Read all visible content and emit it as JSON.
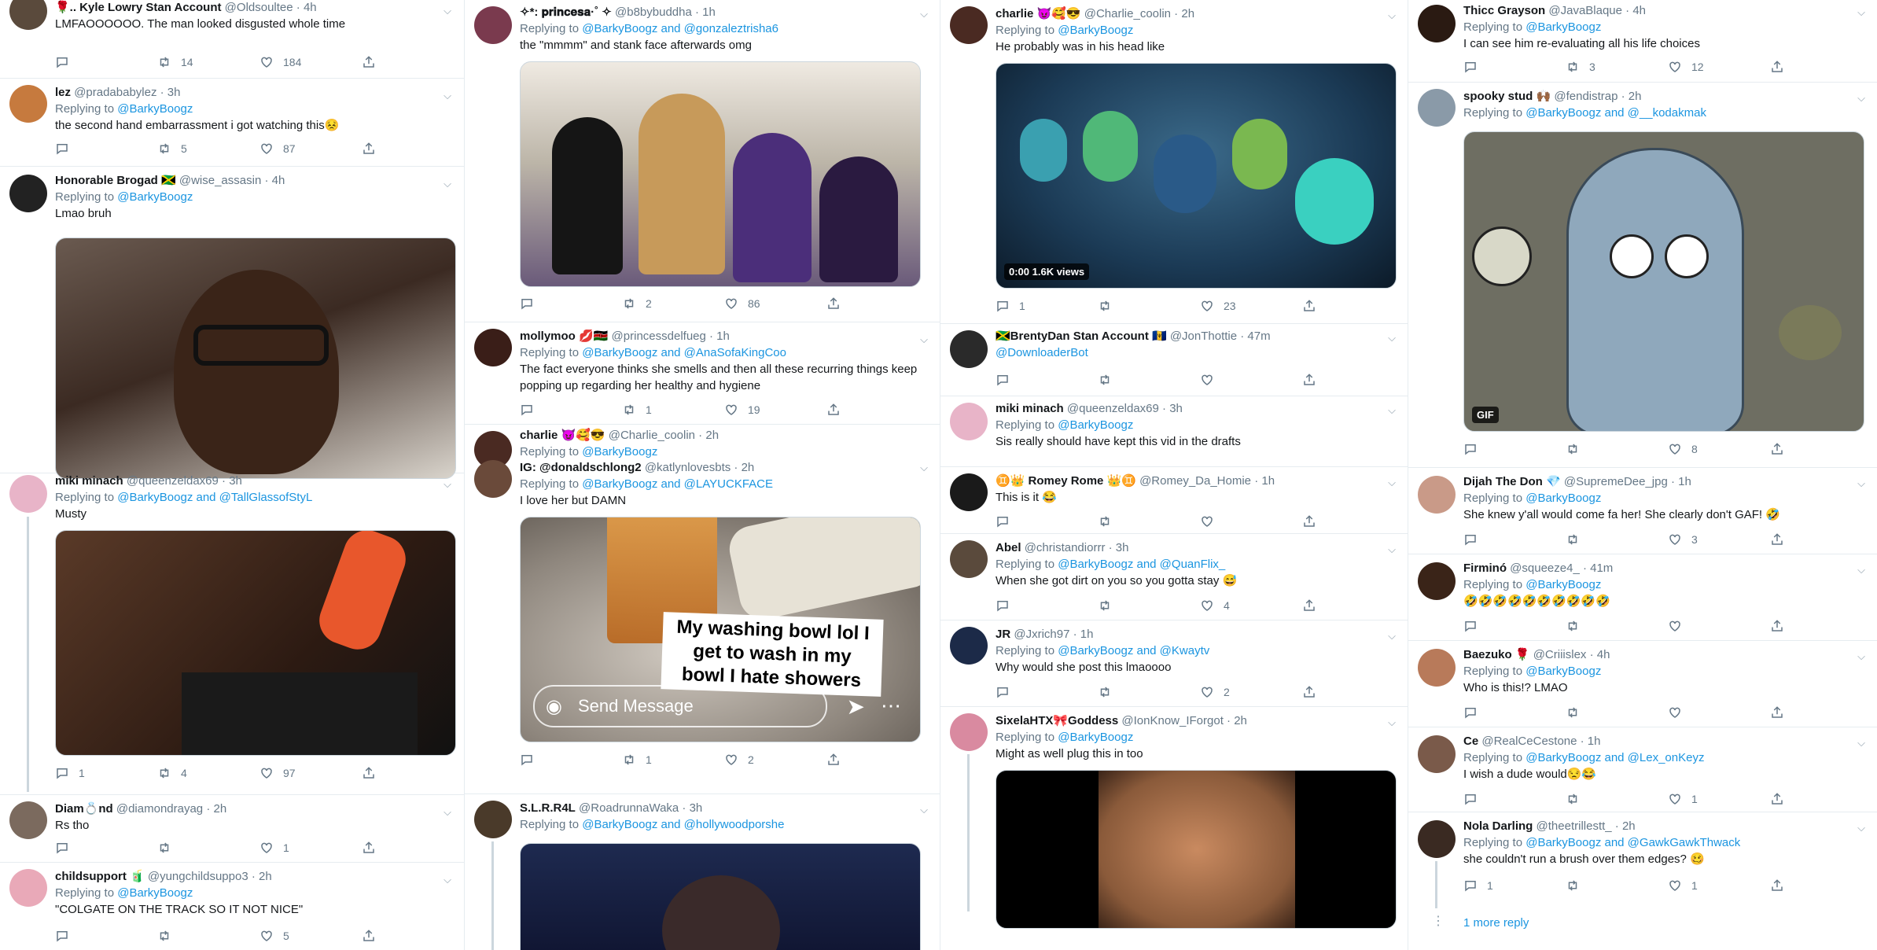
{
  "col1": [
    {
      "name": "🌹.. Kyle Lowry Stan Account",
      "handle": "@Oldsoultee · 4h",
      "text": "LMFAOOOOOO. The man looked disgusted whole time",
      "reply_to": "@BarkyBoogz",
      "replies": "",
      "retweets": "14",
      "likes": "184"
    },
    {
      "name": "lez",
      "handle": "@pradababylez · 3h",
      "reply_to": "@BarkyBoogz",
      "text": "the second hand embarrassment i got watching this😣",
      "replies": "",
      "retweets": "5",
      "likes": "87"
    },
    {
      "name": "Honorable Brogad 🇯🇲",
      "handle": "@wise_assasin · 4h",
      "reply_to": "@BarkyBoogz",
      "text": "Lmao bruh"
    },
    {
      "name": "miki minach",
      "handle": "@queenzeldax69 · 3h",
      "reply_to": "@BarkyBoogz and @TallGlassofStyL",
      "text": "Musty",
      "replies": "1",
      "retweets": "4",
      "likes": "97"
    },
    {
      "name": "Diam💍nd",
      "handle": "@diamondrayag · 2h",
      "text": "Rs tho",
      "replies": "",
      "retweets": "",
      "likes": "1"
    },
    {
      "name": "childsupport 🧃",
      "handle": "@yungchildsuppo3 · 2h",
      "reply_to": "@BarkyBoogz",
      "text": "\"COLGATE ON THE TRACK SO IT NOT NICE\"",
      "replies": "",
      "retweets": "",
      "likes": "5"
    }
  ],
  "col2": [
    {
      "name": "✧*: 𝐩𝐫𝐢𝐧𝐜𝐞𝐬𝐚·˚ ✧",
      "handle": "@b8bybuddha · 1h",
      "reply_to": "@BarkyBoogz and @gonzaleztrisha6",
      "text": "the \"mmmm\" and stank face afterwards omg",
      "replies": "",
      "retweets": "2",
      "likes": "86"
    },
    {
      "name": "mollymoo 💋🇰🇪",
      "handle": "@princessdelfueg · 1h",
      "reply_to": "@BarkyBoogz and @AnaSofaKingCoo",
      "text": "The fact everyone thinks she smells and then all these recurring things keep popping up regarding her healthy and hygiene",
      "replies": "",
      "retweets": "1",
      "likes": "19"
    },
    {
      "name": "charlie 😈🥰😎",
      "handle": "@Charlie_coolin · 2h",
      "reply_to": "@BarkyBoogz"
    },
    {
      "name": "IG: @donaldschlong2",
      "handle": "@katlynlovesbts · 2h",
      "reply_to": "@BarkyBoogz and @LAYUCKFACE",
      "text": "I love her but DAMN",
      "caption": "My washing bowl lol I get to wash in my bowl I hate showers",
      "send_message": "Send Message",
      "replies": "",
      "retweets": "1",
      "likes": "2"
    },
    {
      "name": "S.L.R.R4L",
      "handle": "@RoadrunnaWaka · 3h",
      "reply_to": "@BarkyBoogz and @hollywoodporshe"
    }
  ],
  "col3": [
    {
      "name": "charlie 😈🥰😎",
      "handle": "@Charlie_coolin · 2h",
      "reply_to": "@BarkyBoogz",
      "text": "He probably was in his head like",
      "badge": "0:00  1.6K views",
      "replies": "1",
      "retweets": "",
      "likes": "23"
    },
    {
      "name": "🇯🇲BrentyDan Stan Account 🇧🇧",
      "handle": "@JonThottie · 47m",
      "text": "@DownloaderBot",
      "replies": "",
      "retweets": "",
      "likes": ""
    },
    {
      "name": "miki minach",
      "handle": "@queenzeldax69 · 3h",
      "reply_to": "@BarkyBoogz",
      "text": "Sis really should have kept this vid in the drafts"
    },
    {
      "name": "♊👑 Romey Rome 👑♊",
      "handle": "@Romey_Da_Homie · 1h",
      "text": "This is it 😂",
      "replies": "",
      "retweets": "",
      "likes": ""
    },
    {
      "name": "Abel",
      "handle": "@christandiorrr · 3h",
      "reply_to": "@BarkyBoogz and @QuanFlix_",
      "text": "When she got dirt on you so you gotta stay 😅",
      "replies": "",
      "retweets": "",
      "likes": "4"
    },
    {
      "name": "JR",
      "handle": "@Jxrich97 · 1h",
      "reply_to": "@BarkyBoogz and @Kwaytv",
      "text": "Why would she post this lmaoooo",
      "replies": "",
      "retweets": "",
      "likes": "2"
    },
    {
      "name": "SixelaHTX🎀Goddess",
      "handle": "@IonKnow_IForgot · 2h",
      "reply_to": "@BarkyBoogz",
      "text": "Might as well plug this in too"
    }
  ],
  "col4": [
    {
      "name": "Thicc Grayson",
      "handle": "@JavaBlaque · 4h",
      "reply_to": "@BarkyBoogz",
      "text": "I can see him re-evaluating all his life choices",
      "replies": "",
      "retweets": "3",
      "likes": "12"
    },
    {
      "name": "spooky stud 🙌🏾",
      "handle": "@fendistrap · 2h",
      "reply_to": "@BarkyBoogz and @__kodakmak",
      "badge": "GIF",
      "replies": "",
      "retweets": "",
      "likes": "8"
    },
    {
      "name": "Dijah The Don 💎",
      "handle": "@SupremeDee_jpg · 1h",
      "reply_to": "@BarkyBoogz",
      "text": "She knew y'all would come fa her! She clearly don't GAF! 🤣",
      "replies": "",
      "retweets": "",
      "likes": "3"
    },
    {
      "name": "Firminó",
      "handle": "@squeeze4_ · 41m",
      "reply_to": "@BarkyBoogz",
      "text": "🤣🤣🤣🤣🤣🤣🤣🤣🤣🤣",
      "replies": "",
      "retweets": "",
      "likes": ""
    },
    {
      "name": "Baezuko 🌹",
      "handle": "@Criiislex · 4h",
      "reply_to": "@BarkyBoogz",
      "text": "Who is this!? LMAO",
      "replies": "",
      "retweets": "",
      "likes": ""
    },
    {
      "name": "Ce",
      "handle": "@RealCeCestone · 1h",
      "reply_to": "@BarkyBoogz and @Lex_onKeyz",
      "text": "I wish a dude would😒😂",
      "replies": "",
      "retweets": "",
      "likes": "1"
    },
    {
      "name": "Nola Darling",
      "handle": "@theetrillestt_ · 2h",
      "reply_to": "@BarkyBoogz and @GawkGawkThwack",
      "text": "she couldn't run a brush over them edges? 🥴",
      "replies": "1",
      "retweets": "",
      "likes": "1",
      "more": "1 more reply"
    }
  ],
  "labels": {
    "replying_to": "Replying to"
  },
  "colors": {
    "link": "#1b95e0",
    "muted": "#657786",
    "border": "#e6ecf0"
  }
}
